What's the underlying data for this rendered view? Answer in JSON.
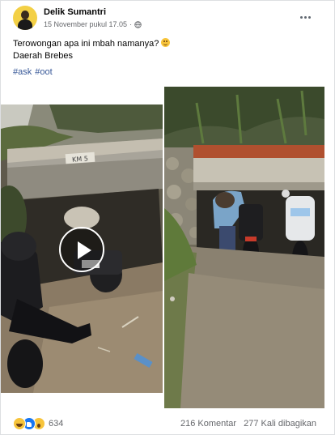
{
  "post": {
    "author": "Delik Sumantri",
    "timestamp": "15 November pukul 17.05",
    "privacy_icon": "globe-icon",
    "caption_line1": "Terowongan apa ini mbah namanya?",
    "caption_line2": "Daerah Brebes",
    "hashtags": [
      "#ask",
      "#oot"
    ]
  },
  "media": {
    "left_label": "video-frame-motorbike-under-bridge",
    "left_sign": "KM 5",
    "right_label": "photo-motorbike-under-bridge"
  },
  "footer": {
    "reaction_icons": [
      "haha-icon",
      "like-icon",
      "wow-icon"
    ],
    "reaction_count": "634",
    "comments": "216 Komentar",
    "shares": "277 Kali dibagikan"
  },
  "colors": {
    "link": "#385898",
    "secondary_text": "#65676b",
    "border": "#dddfe2"
  }
}
